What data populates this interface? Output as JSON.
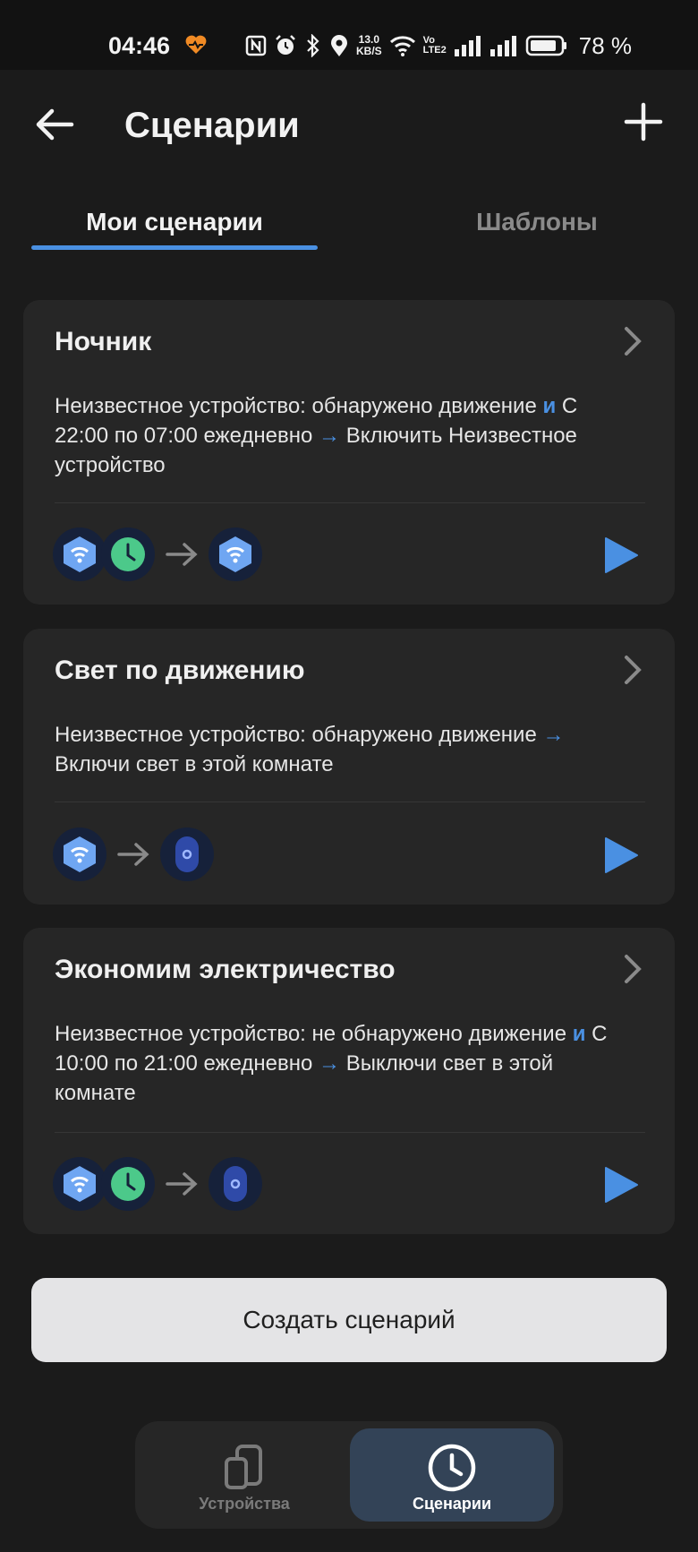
{
  "status_bar": {
    "time": "04:46",
    "net_speed_value": "13.0",
    "net_speed_unit": "KB/S",
    "volte_top": "Vo",
    "volte_bottom": "LTE2",
    "battery_percent": "78 %",
    "icons": [
      "heart-pulse-icon",
      "nfc-icon",
      "alarm-icon",
      "bluetooth-icon",
      "location-icon",
      "wifi-icon",
      "signal-icon",
      "signal-icon",
      "battery-icon"
    ]
  },
  "app_bar": {
    "title": "Сценарии",
    "back_icon": "arrow-left-icon",
    "add_icon": "plus-icon"
  },
  "tabs": [
    {
      "label": "Мои сценарии",
      "active": true
    },
    {
      "label": "Шаблоны",
      "active": false
    }
  ],
  "scenarios": [
    {
      "title": "Ночник",
      "desc_parts": [
        "Неизвестное устройство: обнаружено движение ",
        "и",
        " С 22:00 по 07:00 ежедневно ",
        "→",
        " Включить Неизвестное устройство"
      ],
      "trigger_icons": [
        "motion-sensor-icon",
        "clock-icon"
      ],
      "action_icons": [
        "motion-sensor-icon"
      ]
    },
    {
      "title": "Свет по движению",
      "desc_parts": [
        "Неизвестное устройство: обнаружено движение ",
        "→",
        " Включи свет в этой комнате"
      ],
      "trigger_icons": [
        "motion-sensor-icon"
      ],
      "action_icons": [
        "light-switch-icon"
      ]
    },
    {
      "title": "Экономим электричество",
      "desc_parts": [
        "Неизвестное устройство: не обнаружено движение ",
        "и",
        " С 10:00 по 21:00 ежедневно ",
        "→",
        " Выключи свет в этой комнате"
      ],
      "trigger_icons": [
        "motion-sensor-icon",
        "clock-icon"
      ],
      "action_icons": [
        "light-switch-icon"
      ]
    }
  ],
  "create_button": {
    "label": "Создать сценарий"
  },
  "bottom_nav": [
    {
      "label": "Устройства",
      "icon": "devices-icon",
      "active": false
    },
    {
      "label": "Сценарии",
      "icon": "clock-icon",
      "active": true
    }
  ],
  "colors": {
    "background": "#1b1b1b",
    "card": "#262626",
    "accent": "#4a90e2",
    "clock_green": "#4cc98a",
    "nav_active": "#334357"
  }
}
